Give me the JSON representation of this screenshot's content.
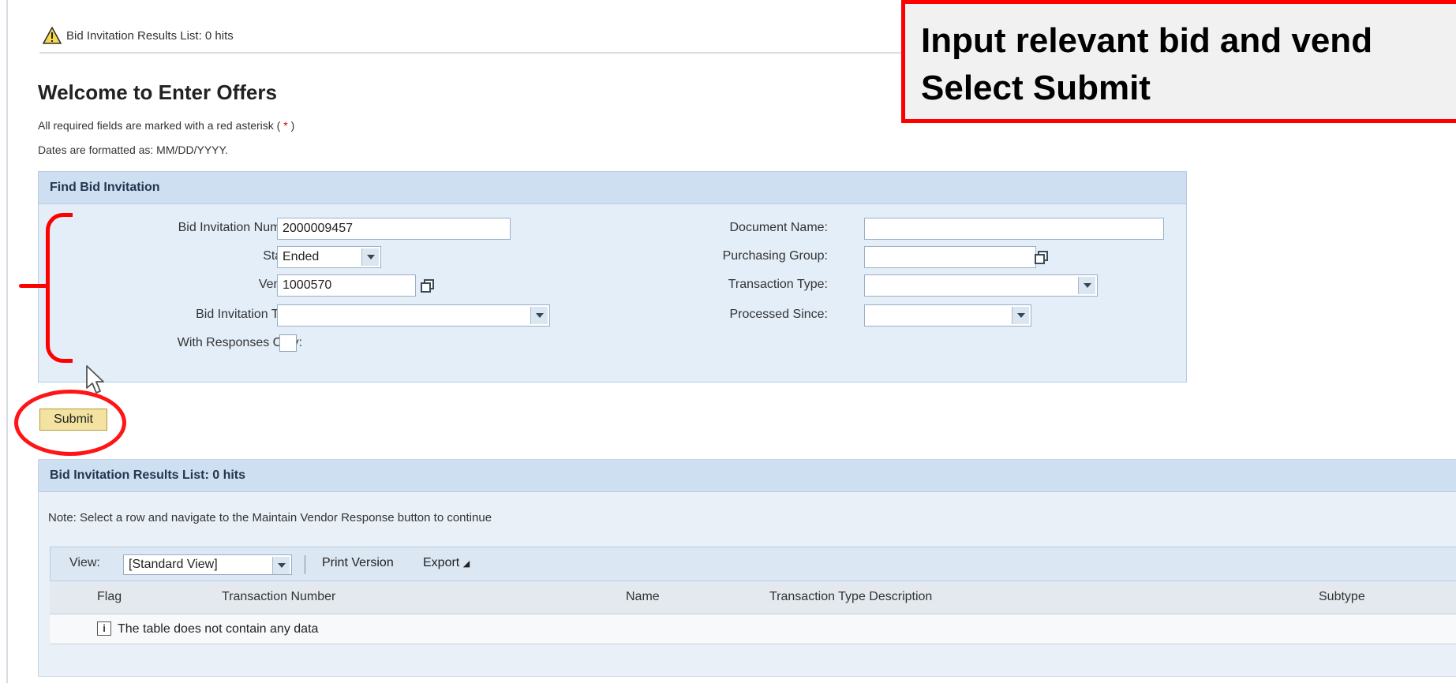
{
  "message_bar": {
    "text": "Bid Invitation Results List: 0 hits",
    "icon": "warning-icon"
  },
  "page": {
    "title": "Welcome to Enter Offers",
    "required_note_prefix": "All required fields are marked with a red asterisk (",
    "required_note_asterisk": " * ",
    "required_note_suffix": ")",
    "date_note": "Dates are formatted as: MM/DD/YYYY."
  },
  "find_panel": {
    "title": "Find Bid Invitation",
    "fields": {
      "bid_invitation_number": {
        "label": "Bid Invitation Number:",
        "value": "2000009457"
      },
      "status": {
        "label": "Status:",
        "value": "Ended"
      },
      "vendor": {
        "label": "Vendor:",
        "value": "1000570"
      },
      "bid_invitation_type": {
        "label": "Bid Invitation Type:",
        "value": ""
      },
      "with_responses_only": {
        "label": "With Responses Only:",
        "checked": false
      },
      "document_name": {
        "label": "Document Name:",
        "value": ""
      },
      "purchasing_group": {
        "label": "Purchasing Group:",
        "value": ""
      },
      "transaction_type": {
        "label": "Transaction Type:",
        "value": ""
      },
      "processed_since": {
        "label": "Processed Since:",
        "value": ""
      }
    }
  },
  "submit_label": "Submit",
  "callout": {
    "line1": "Input relevant bid and vend",
    "line2": "Select Submit",
    "border_color": "#ff0000"
  },
  "results": {
    "title": "Bid Invitation Results List: 0 hits",
    "note": "Note: Select a row and navigate to the Maintain Vendor Response button to continue",
    "toolbar": {
      "view_label": "View:",
      "view_value": "[Standard View]",
      "print_version": "Print Version",
      "export": "Export"
    },
    "columns": [
      "Flag",
      "Transaction Number",
      "Name",
      "Transaction Type Description",
      "Subtype"
    ],
    "empty_message": "The table does not contain any data"
  },
  "colors": {
    "annotation_red": "#ff0000",
    "submit_bg": "#f3e2a0",
    "panel_header": "#cddff0"
  }
}
